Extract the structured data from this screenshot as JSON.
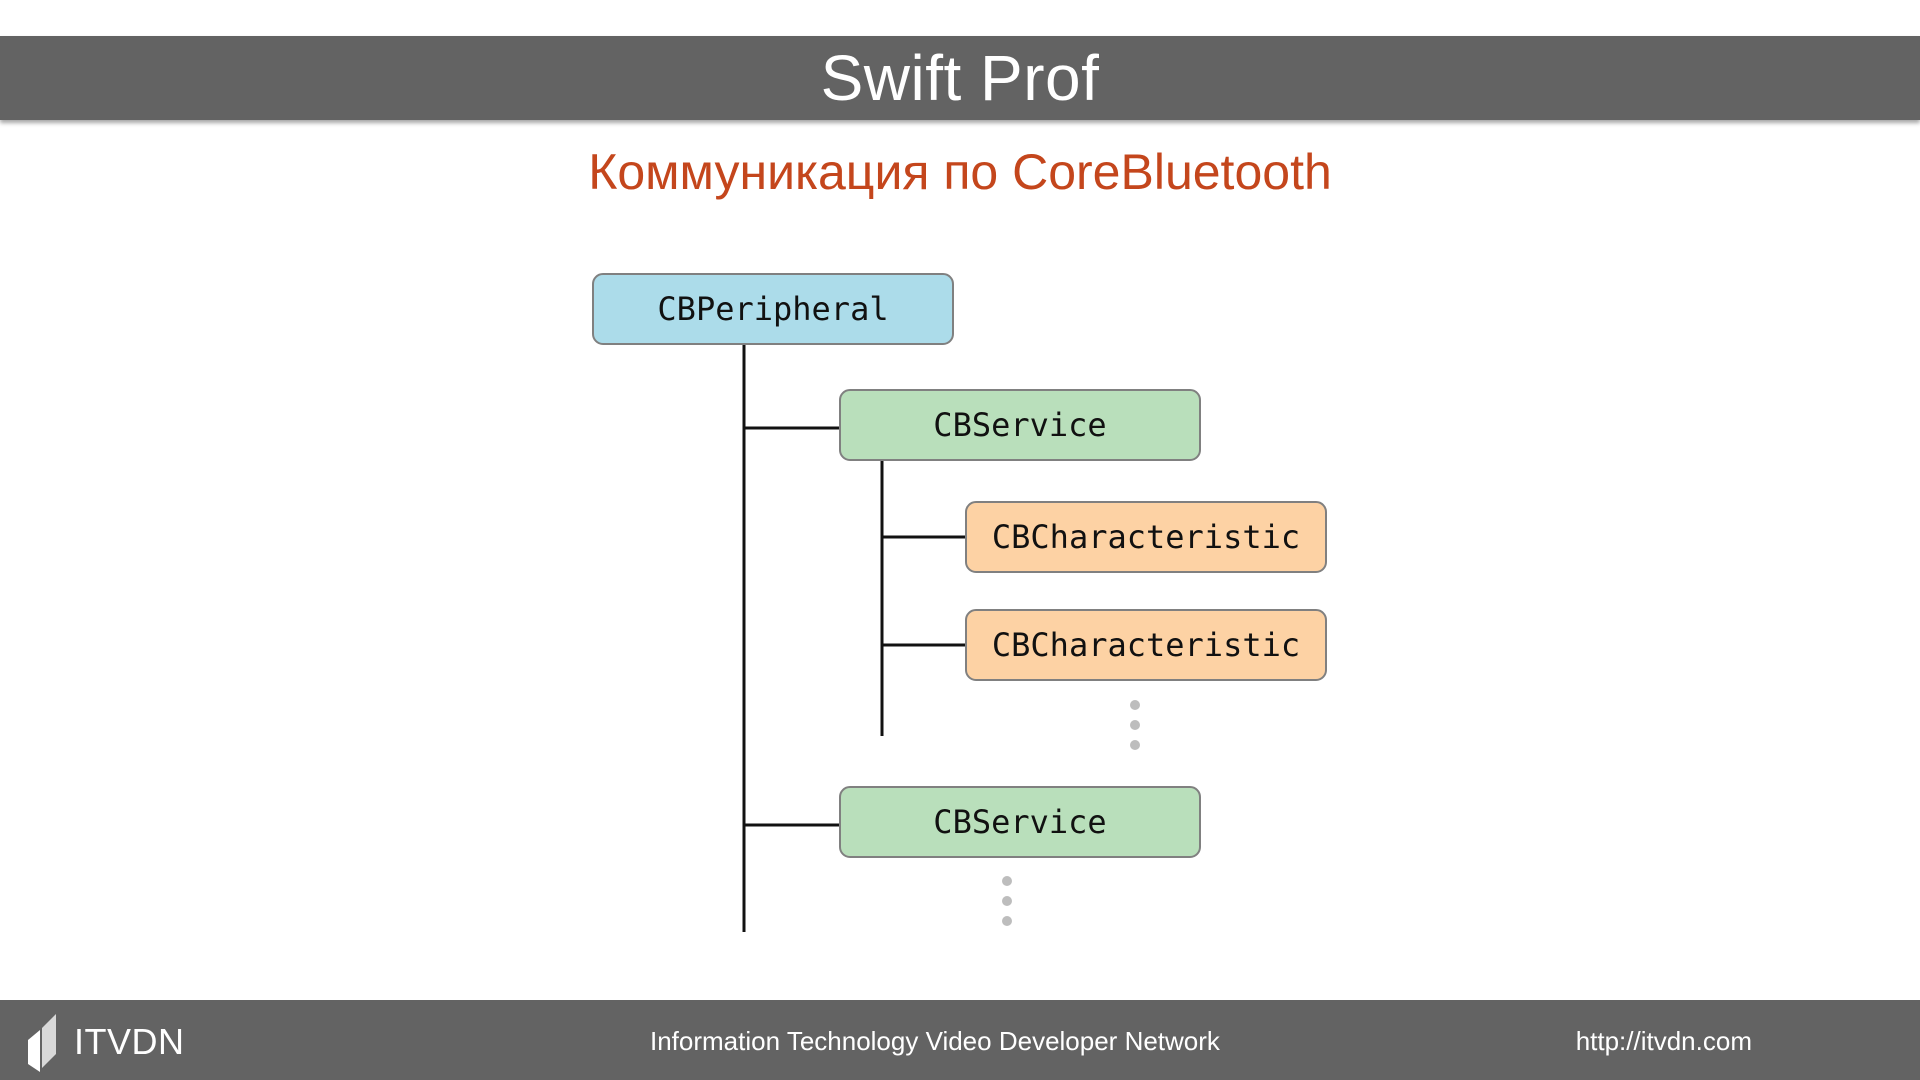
{
  "header": {
    "title": "Swift Prof"
  },
  "subtitle": "Коммуникация по CoreBluetooth",
  "diagram": {
    "nodes": {
      "peripheral": {
        "label": "CBPeripheral",
        "kind": "peripheral"
      },
      "service_1": {
        "label": "CBService",
        "kind": "service"
      },
      "characteristic_1": {
        "label": "CBCharacteristic",
        "kind": "characteristic"
      },
      "characteristic_2": {
        "label": "CBCharacteristic",
        "kind": "characteristic"
      },
      "service_2": {
        "label": "CBService",
        "kind": "service"
      }
    },
    "colors": {
      "peripheral_fill": "#acdcea",
      "service_fill": "#b9dfbb",
      "characteristic_fill": "#fdd2a4",
      "node_border": "#808080",
      "connector": "#111111",
      "ellipsis_dots": "#bdbdbd"
    }
  },
  "footer": {
    "brand": "ITVDN",
    "tagline": "Information Technology Video Developer Network",
    "url": "http://itvdn.com"
  },
  "colors": {
    "bar_background": "#636363",
    "subtitle": "#c4461c"
  }
}
